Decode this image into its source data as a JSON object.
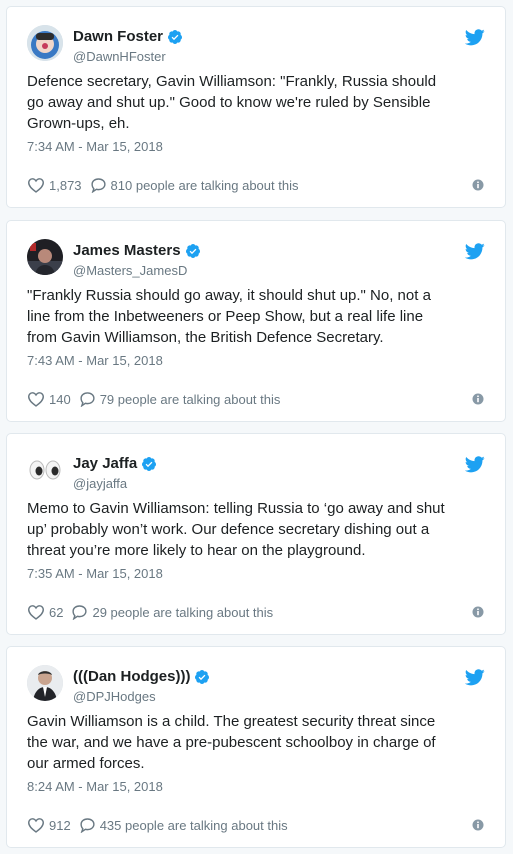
{
  "tweets": [
    {
      "name": "Dawn Foster",
      "handle": "@DawnHFoster",
      "text": "Defence secretary, Gavin Williamson: \"Frankly, Russia should\ngo away and shut up.\" Good to know we're ruled by Sensible\nGrown-ups, eh.",
      "time": "7:34 AM - Mar 15, 2018",
      "likes": "1,873",
      "talking": "810 people are talking about this",
      "avatar_icon": "avatar-dawn-icon"
    },
    {
      "name": "James Masters",
      "handle": "@Masters_JamesD",
      "text": "\"Frankly Russia should go away, it should shut up.\" No, not a\nline from the Inbetweeners or Peep Show, but a real life line\nfrom Gavin Williamson, the British Defence Secretary.",
      "time": "7:43 AM - Mar 15, 2018",
      "likes": "140",
      "talking": "79 people are talking about this",
      "avatar_icon": "avatar-james-icon"
    },
    {
      "name": "Jay Jaffa",
      "handle": "@jayjaffa",
      "text": "Memo to Gavin Williamson: telling Russia to ‘go away and shut\nup’ probably won’t work. Our defence secretary dishing out a\nthreat you’re more likely to hear on the playground.",
      "time": "7:35 AM - Mar 15, 2018",
      "likes": "62",
      "talking": "29 people are talking about this",
      "avatar_icon": "eyes-emoji-icon"
    },
    {
      "name": "(((Dan Hodges)))",
      "handle": "@DPJHodges",
      "text": "Gavin Williamson is a child. The greatest security threat since\nthe war, and we have a pre-pubescent schoolboy in charge of\nour armed forces.",
      "time": "8:24 AM - Mar 15, 2018",
      "likes": "912",
      "talking": "435 people are talking about this",
      "avatar_icon": "avatar-dan-icon"
    }
  ],
  "colors": {
    "verified": "#1da1f2",
    "twitter_bird": "#1da1f2",
    "meta_text": "#697882",
    "border": "#e1e8ed"
  }
}
